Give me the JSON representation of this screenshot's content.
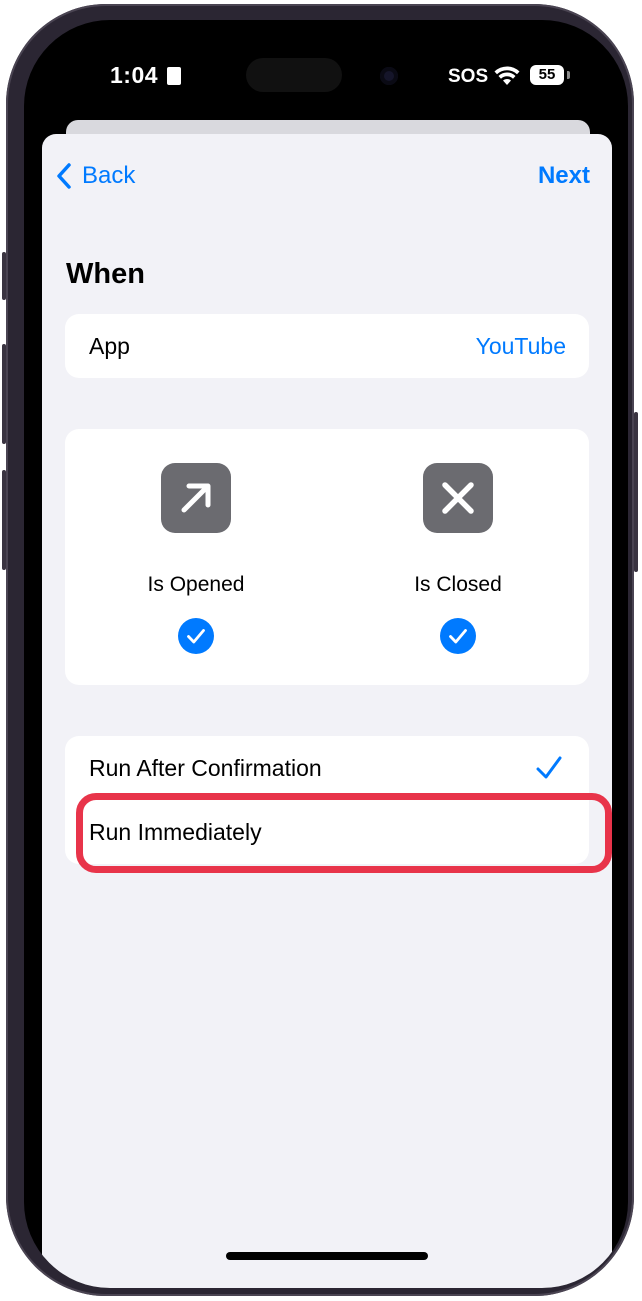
{
  "status_bar": {
    "time": "1:04",
    "sos": "SOS",
    "battery": "55",
    "icons": [
      "person-card-icon",
      "wifi-icon",
      "battery-icon"
    ]
  },
  "nav": {
    "back_label": "Back",
    "next_label": "Next"
  },
  "section": {
    "title": "When"
  },
  "app_row": {
    "label": "App",
    "value": "YouTube"
  },
  "triggers": [
    {
      "label": "Is Opened",
      "icon": "arrow-up-right-icon",
      "checked": true
    },
    {
      "label": "Is Closed",
      "icon": "x-mark-icon",
      "checked": true
    }
  ],
  "run_options": [
    {
      "label": "Run After Confirmation",
      "selected": true
    },
    {
      "label": "Run Immediately",
      "selected": false
    }
  ],
  "colors": {
    "accent": "#007aff",
    "background": "#f2f2f7",
    "highlight": "#e8344a",
    "icon_tile": "#6b6b70"
  }
}
